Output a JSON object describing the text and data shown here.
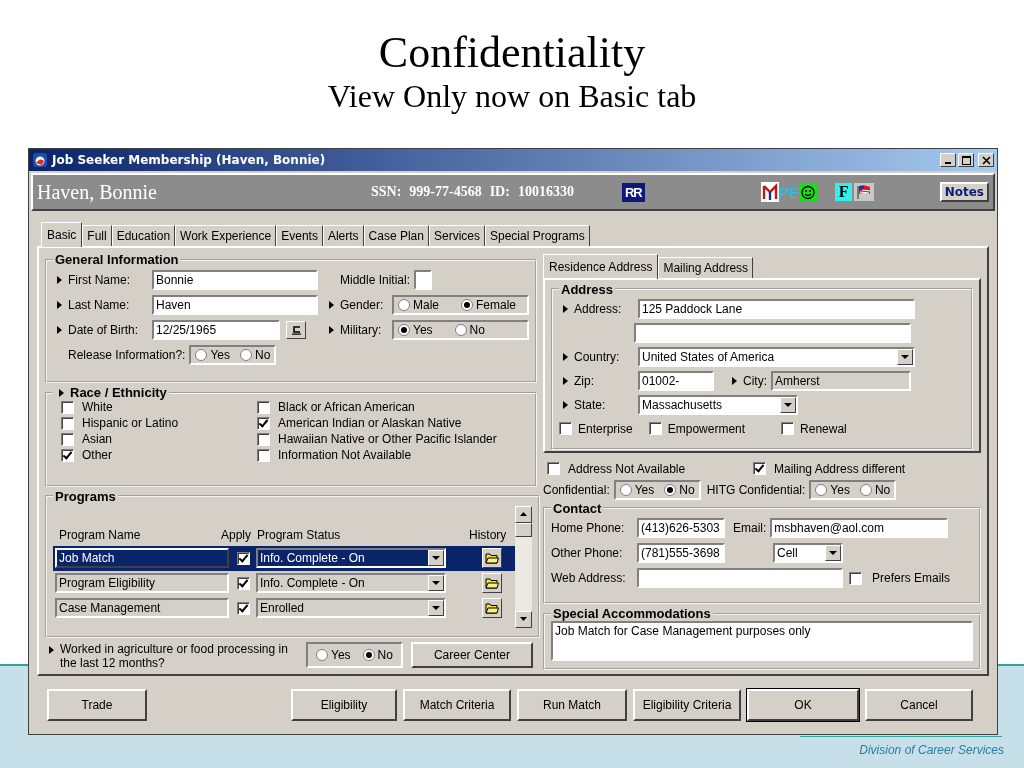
{
  "slide": {
    "title": "Confidentiality",
    "subtitle": "View Only now on Basic tab",
    "footer": "Division of Career Services"
  },
  "window": {
    "title": "Job Seeker Membership (Haven, Bonnie)"
  },
  "header": {
    "name": "Haven, Bonnie",
    "ssn_label": "SSN:",
    "ssn": "999-77-4568",
    "id_label": "ID:",
    "id": "10016330",
    "notes": "Notes",
    "badges": [
      {
        "kind": "rr",
        "text": "RR"
      },
      {
        "kind": "logo"
      },
      {
        "kind": "pe",
        "text": "PE"
      },
      {
        "kind": "smiley"
      },
      {
        "kind": "f",
        "text": "F"
      },
      {
        "kind": "flag"
      }
    ]
  },
  "tabs": [
    {
      "label": "Basic",
      "selected": true
    },
    {
      "label": "Full",
      "selected": false
    },
    {
      "label": "Education",
      "selected": false
    },
    {
      "label": "Work Experience",
      "selected": false
    },
    {
      "label": "Events",
      "selected": false
    },
    {
      "label": "Alerts",
      "selected": false
    },
    {
      "label": "Case Plan",
      "selected": false
    },
    {
      "label": "Services",
      "selected": false
    },
    {
      "label": "Special Programs",
      "selected": false
    }
  ],
  "general": {
    "title": "General Information",
    "first_name": {
      "label": "First Name:",
      "required": true,
      "value": "Bonnie"
    },
    "middle_initial": {
      "label": "Middle Initial:",
      "required": false
    },
    "last_name": {
      "label": "Last Name:",
      "required": true,
      "value": "Haven"
    },
    "gender": {
      "label": "Gender:",
      "required": true,
      "options": [
        {
          "label": "Male",
          "selected": false
        },
        {
          "label": "Female",
          "selected": true
        }
      ]
    },
    "date_of_birth": {
      "label": "Date of Birth:",
      "required": true,
      "value": "12/25/1965"
    },
    "military": {
      "label": "Military:",
      "required": true,
      "options": [
        {
          "label": "Yes",
          "selected": true
        },
        {
          "label": "No",
          "selected": false
        }
      ]
    },
    "release_information": {
      "label": "Release Information?:",
      "required": false,
      "options": [
        {
          "label": "Yes",
          "selected": false
        },
        {
          "label": "No",
          "selected": false
        }
      ]
    }
  },
  "race": {
    "title": "Race / Ethnicity",
    "required": true,
    "options": [
      {
        "label": "White",
        "checked": false
      },
      {
        "label": "Black or African American",
        "checked": false
      },
      {
        "label": "Hispanic or Latino",
        "checked": false
      },
      {
        "label": "American Indian or Alaskan Native",
        "checked": true
      },
      {
        "label": "Asian",
        "checked": false
      },
      {
        "label": "Hawaiian Native or Other Pacific Islander",
        "checked": false
      },
      {
        "label": "Other",
        "checked": true
      },
      {
        "label": "Information Not Available",
        "checked": false
      }
    ]
  },
  "programs": {
    "title": "Programs",
    "columns": [
      "Program Name",
      "Apply",
      "Program Status",
      "History"
    ],
    "rows": [
      {
        "name": "Job Match",
        "apply": true,
        "status": "Info. Complete - On",
        "selected": true
      },
      {
        "name": "Program Eligibility",
        "apply": true,
        "status": "Info. Complete - On",
        "selected": false
      },
      {
        "name": "Case Management",
        "apply": true,
        "status": "Enrolled",
        "selected": false
      }
    ]
  },
  "agriculture": {
    "question": "Worked in agriculture or food processing in the last 12 months?",
    "required": true,
    "options": [
      {
        "label": "Yes",
        "selected": false
      },
      {
        "label": "No",
        "selected": true
      }
    ],
    "button": "Career Center"
  },
  "address_tabs": [
    {
      "label": "Residence Address",
      "selected": true
    },
    {
      "label": "Mailing Address",
      "selected": false
    }
  ],
  "address": {
    "title": "Address",
    "address": {
      "label": "Address:",
      "required": true,
      "value": "125 Paddock Lane"
    },
    "country": {
      "label": "Country:",
      "required": true,
      "value": "United States of America"
    },
    "zip": {
      "label": "Zip:",
      "required": true,
      "value": "01002-"
    },
    "city": {
      "label": "City:",
      "required": true,
      "value": "Amherst"
    },
    "state": {
      "label": "State:",
      "required": true,
      "value": "Massachusetts"
    },
    "flags": [
      {
        "label": "Enterprise",
        "checked": false
      },
      {
        "label": "Empowerment",
        "checked": false
      },
      {
        "label": "Renewal",
        "checked": false
      }
    ]
  },
  "address_not_available": {
    "label": "Address Not Available",
    "checked": false
  },
  "mailing_address_different": {
    "label": "Mailing Address different",
    "checked": true
  },
  "confidential": {
    "label": "Confidential:",
    "options": [
      {
        "label": "Yes",
        "selected": false
      },
      {
        "label": "No",
        "selected": true
      }
    ]
  },
  "hitg_confidential": {
    "label": "HITG Confidential:",
    "options": [
      {
        "label": "Yes",
        "selected": false
      },
      {
        "label": "No",
        "selected": false
      }
    ]
  },
  "contact": {
    "title": "Contact",
    "home_phone": {
      "label": "Home Phone:",
      "value": "(413)626-5303"
    },
    "email": {
      "label": "Email:",
      "value": "msbhaven@aol.com"
    },
    "other_phone": {
      "label": "Other  Phone:",
      "value": "(781)555-3698"
    },
    "phone_type": {
      "value": "Cell"
    },
    "web_address": {
      "label": "Web Address:"
    },
    "prefers_emails": {
      "label": "Prefers Emails",
      "checked": false
    }
  },
  "accommodations": {
    "title": "Special Accommodations",
    "value": "Job Match for Case Management purposes only"
  },
  "buttons": [
    {
      "label": "Trade",
      "default": false
    },
    {
      "label": "Eligibility",
      "default": false
    },
    {
      "label": "Match Criteria",
      "default": false
    },
    {
      "label": "Run Match",
      "default": false
    },
    {
      "label": "Eligibility Criteria",
      "default": false
    },
    {
      "label": "OK",
      "default": true
    },
    {
      "label": "Cancel",
      "default": false
    }
  ]
}
